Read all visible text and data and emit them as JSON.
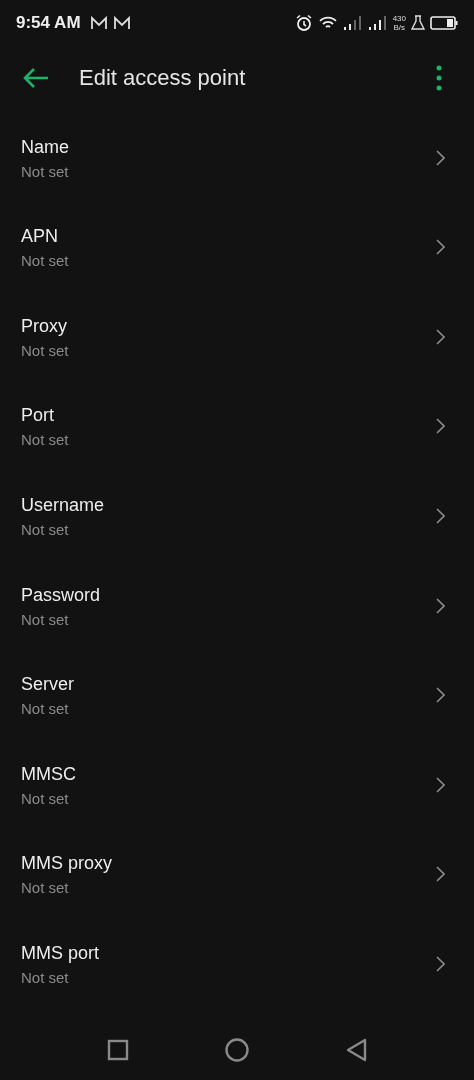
{
  "status_bar": {
    "time": "9:54 AM",
    "speed_value": "430",
    "speed_unit": "B/s"
  },
  "app_bar": {
    "title": "Edit access point"
  },
  "settings": [
    {
      "label": "Name",
      "value": "Not set"
    },
    {
      "label": "APN",
      "value": "Not set"
    },
    {
      "label": "Proxy",
      "value": "Not set"
    },
    {
      "label": "Port",
      "value": "Not set"
    },
    {
      "label": "Username",
      "value": "Not set"
    },
    {
      "label": "Password",
      "value": "Not set"
    },
    {
      "label": "Server",
      "value": "Not set"
    },
    {
      "label": "MMSC",
      "value": "Not set"
    },
    {
      "label": "MMS proxy",
      "value": "Not set"
    },
    {
      "label": "MMS port",
      "value": "Not set"
    }
  ]
}
